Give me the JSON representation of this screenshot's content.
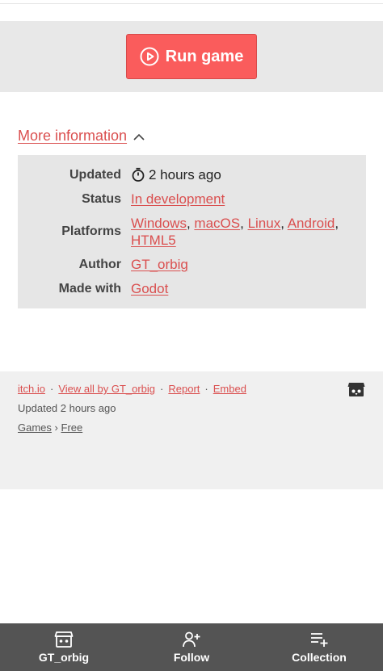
{
  "run": {
    "label": "Run game",
    "icon": "play-circle-icon",
    "color": "#fa5c5c"
  },
  "more_info": {
    "label": "More information",
    "icon": "chevron-up-icon"
  },
  "info": {
    "updated": {
      "label": "Updated",
      "value": "2 hours ago",
      "icon": "timer-icon"
    },
    "status": {
      "label": "Status",
      "value": "In development"
    },
    "platforms": {
      "label": "Platforms",
      "items": [
        "Windows",
        "macOS",
        "Linux",
        "Android",
        "HTML5"
      ]
    },
    "author": {
      "label": "Author",
      "value": "GT_orbig"
    },
    "made_with": {
      "label": "Made with",
      "value": "Godot"
    }
  },
  "footer": {
    "links": [
      "itch.io",
      "View all by GT_orbig",
      "Report",
      "Embed"
    ],
    "separator": "·",
    "updated": "Updated 2 hours ago",
    "crumbs": [
      "Games",
      "Free"
    ],
    "crumb_separator": "›",
    "logo_icon": "itchio-logo-icon"
  },
  "bottom_nav": [
    {
      "label": "GT_orbig",
      "icon": "itchio-store-icon"
    },
    {
      "label": "Follow",
      "icon": "add-user-icon"
    },
    {
      "label": "Collection",
      "icon": "add-to-list-icon"
    }
  ],
  "colors": {
    "accent": "#da4f4f",
    "button": "#fa5c5c",
    "panel": "#e6e6e6",
    "nav": "#545454"
  }
}
